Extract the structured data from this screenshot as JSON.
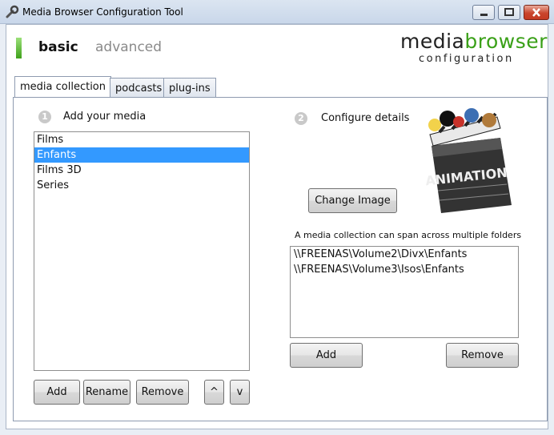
{
  "window": {
    "title": "Media Browser Configuration Tool"
  },
  "modes": {
    "basic": "basic",
    "advanced": "advanced"
  },
  "logo": {
    "part1": "media",
    "part2": "browser",
    "subtitle": "configuration"
  },
  "tabs": [
    {
      "label": "media collection",
      "active": true
    },
    {
      "label": "podcasts",
      "active": false
    },
    {
      "label": "plug-ins",
      "active": false
    }
  ],
  "step1": {
    "number": "1",
    "label": "Add your media"
  },
  "step2": {
    "number": "2",
    "label": "Configure details"
  },
  "collections": {
    "items": [
      "Films",
      "Enfants",
      "Films 3D",
      "Series"
    ],
    "selected_index": 1
  },
  "collection_buttons": {
    "add": "Add",
    "rename": "Rename",
    "remove": "Remove",
    "up": "^",
    "down": "v"
  },
  "image": {
    "caption": "ANIMATION",
    "change_label": "Change Image"
  },
  "folders": {
    "hint": "A media collection can span across multiple folders",
    "items": [
      "\\\\FREENAS\\Volume2\\Divx\\Enfants",
      "\\\\FREENAS\\Volume3\\Isos\\Enfants"
    ]
  },
  "folder_buttons": {
    "add": "Add",
    "remove": "Remove"
  },
  "colors": {
    "accent_green": "#3aa018",
    "selection_blue": "#3399ff"
  }
}
